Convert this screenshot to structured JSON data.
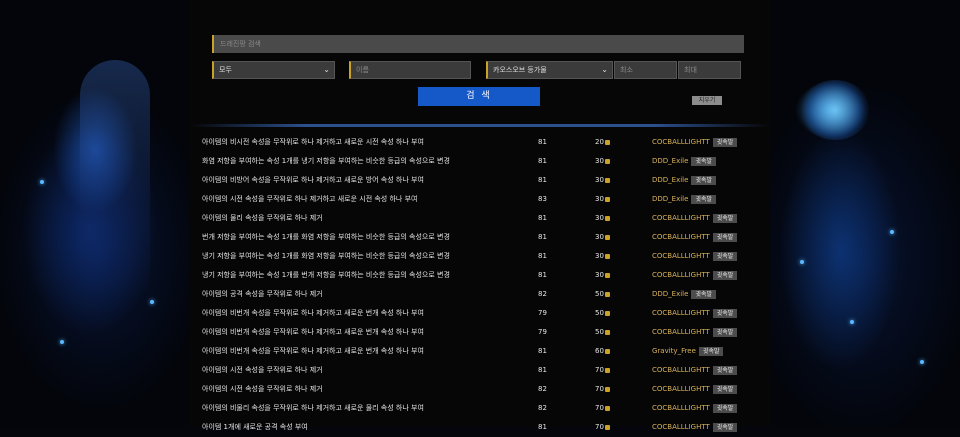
{
  "search": {
    "placeholder": "드레진팡 검색"
  },
  "filters": {
    "category_selected": "모두",
    "name_placeholder": "이름",
    "currency_selected": "카오스오브 등가물",
    "min_placeholder": "최소",
    "max_placeholder": "최대"
  },
  "buttons": {
    "search_label": "검 색",
    "clear_label": "지우기"
  },
  "colors": {
    "accent": "#c9a227",
    "primary": "#1559c9",
    "seller": "#d8b25a"
  },
  "rows": [
    {
      "desc": "아이템의 비시전 속성을 무작위로 하나 제거하고 새로운 시전 속성 하나 부여",
      "level": "81",
      "price": "20",
      "seller": "COCBALLLIGHTT",
      "action": "귓속말"
    },
    {
      "desc": "화염 저항을 부여하는 속성 1개를 냉기 저항을 부여하는 비슷한 등급의 속성으로 변경",
      "level": "81",
      "price": "30",
      "seller": "DDD_Exile",
      "action": "귓속말"
    },
    {
      "desc": "아이템의 비방어 속성을 무작위로 하나 제거하고 새로운 방어 속성 하나 부여",
      "level": "81",
      "price": "30",
      "seller": "DDD_Exile",
      "action": "귓속말"
    },
    {
      "desc": "아이템의 시전 속성을 무작위로 하나 제거하고 새로운 시전 속성 하나 부여",
      "level": "83",
      "price": "30",
      "seller": "DDD_Exile",
      "action": "귓속말"
    },
    {
      "desc": "아이템의 물리 속성을 무작위로 하나 제거",
      "level": "81",
      "price": "30",
      "seller": "COCBALLLIGHTT",
      "action": "귓속말"
    },
    {
      "desc": "번개 저항을 부여하는 속성 1개를 화염 저항을 부여하는 비슷한 등급의 속성으로 변경",
      "level": "81",
      "price": "30",
      "seller": "COCBALLLIGHTT",
      "action": "귓속말"
    },
    {
      "desc": "냉기 저항을 부여하는 속성 1개를 화염 저항을 부여하는 비슷한 등급의 속성으로 변경",
      "level": "81",
      "price": "30",
      "seller": "COCBALLLIGHTT",
      "action": "귓속말"
    },
    {
      "desc": "냉기 저항을 부여하는 속성 1개를 번개 저항을 부여하는 비슷한 등급의 속성으로 변경",
      "level": "81",
      "price": "30",
      "seller": "COCBALLLIGHTT",
      "action": "귓속말"
    },
    {
      "desc": "아이템의 공격 속성을 무작위로 하나 제거",
      "level": "82",
      "price": "50",
      "seller": "DDD_Exile",
      "action": "귓속말"
    },
    {
      "desc": "아이템의 비번개 속성을 무작위로 하나 제거하고 새로운 번개 속성 하나 부여",
      "level": "79",
      "price": "50",
      "seller": "COCBALLLIGHTT",
      "action": "귓속말"
    },
    {
      "desc": "아이템의 비번개 속성을 무작위로 하나 제거하고 새로운 번개 속성 하나 부여",
      "level": "79",
      "price": "50",
      "seller": "COCBALLLIGHTT",
      "action": "귓속말"
    },
    {
      "desc": "아이템의 비번개 속성을 무작위로 하나 제거하고 새로운 번개 속성 하나 부여",
      "level": "81",
      "price": "60",
      "seller": "Gravity_Free",
      "action": "귓속말"
    },
    {
      "desc": "아이템의 시전 속성을 무작위로 하나 제거",
      "level": "81",
      "price": "70",
      "seller": "COCBALLLIGHTT",
      "action": "귓속말"
    },
    {
      "desc": "아이템의 시전 속성을 무작위로 하나 제거",
      "level": "82",
      "price": "70",
      "seller": "COCBALLLIGHTT",
      "action": "귓속말"
    },
    {
      "desc": "아이템의 비물리 속성을 무작위로 하나 제거하고 새로운 물리 속성 하나 부여",
      "level": "82",
      "price": "70",
      "seller": "COCBALLLIGHTT",
      "action": "귓속말"
    },
    {
      "desc": "아이템 1개에 새로운 공격 속성 부여",
      "level": "81",
      "price": "70",
      "seller": "COCBALLLIGHTT",
      "action": "귓속말"
    }
  ]
}
